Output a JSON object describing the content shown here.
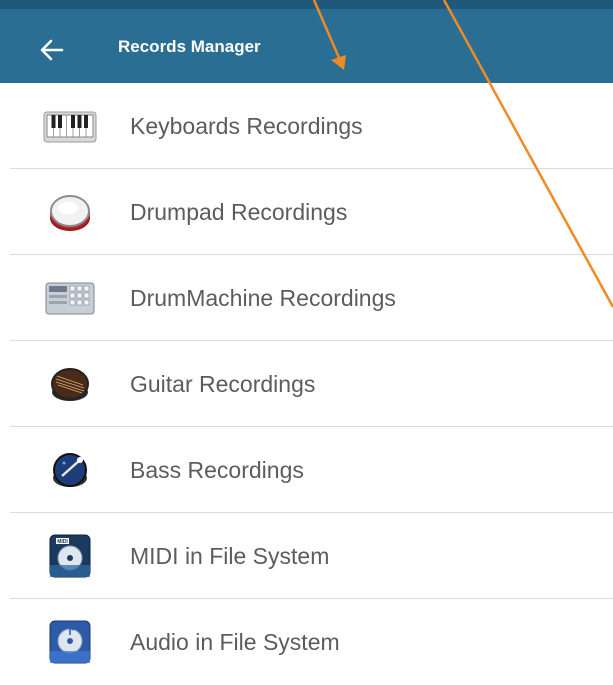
{
  "header": {
    "title": "Records Manager",
    "back_icon": "arrow-left-icon",
    "bg_color": "#2a6e93"
  },
  "list": {
    "items": [
      {
        "label": "Keyboards Recordings",
        "icon": "piano-keyboard-icon"
      },
      {
        "label": "Drumpad Recordings",
        "icon": "drum-icon"
      },
      {
        "label": "DrumMachine Recordings",
        "icon": "drum-machine-icon"
      },
      {
        "label": "Guitar Recordings",
        "icon": "guitar-icon"
      },
      {
        "label": "Bass Recordings",
        "icon": "bass-icon"
      },
      {
        "label": "MIDI in File System",
        "icon": "midi-folder-icon"
      },
      {
        "label": "Audio in File System",
        "icon": "audio-folder-icon"
      }
    ]
  },
  "annotation": {
    "arrow_color": "#f08a24"
  }
}
